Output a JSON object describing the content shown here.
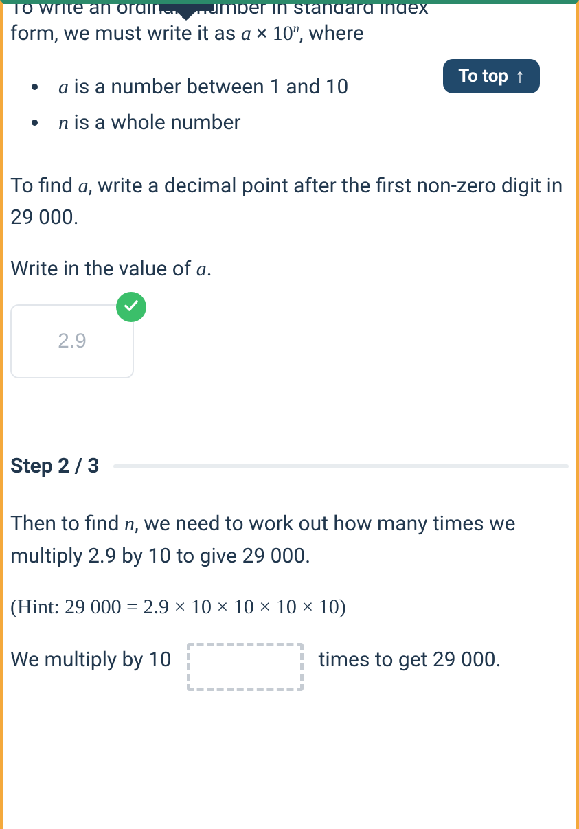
{
  "intro": {
    "truncated_top": "To write an ordinary number in standard index",
    "line_prefix": "form, we must write it as ",
    "var_a": "a",
    "times": " × ",
    "ten": "10",
    "exp": "n",
    "line_suffix": ", where"
  },
  "to_top": {
    "label": "To top"
  },
  "rules": {
    "a_part1": "a",
    "a_part2": " is a number between 1 and 10",
    "n_part1": "n",
    "n_part2": " is a whole number"
  },
  "find_a": {
    "prefix": "To find ",
    "var": "a",
    "suffix": ", write a decimal point after the first non-zero digit in 29 000."
  },
  "prompt_a": {
    "prefix": "Write in the value of ",
    "var": "a",
    "suffix": "."
  },
  "answer_a": {
    "value": "2.9"
  },
  "step2": {
    "label": "Step 2 / 3",
    "find_n_prefix": "Then to find ",
    "find_n_var": "n",
    "find_n_suffix": ", we need to work out how many times we multiply 2.9 by 10 to give 29 000.",
    "hint": "(Hint: 29 000 = 2.9 × 10 × 10 × 10 × 10)",
    "fill_left": "We multiply by 10",
    "fill_right": "times to get 29 000."
  }
}
